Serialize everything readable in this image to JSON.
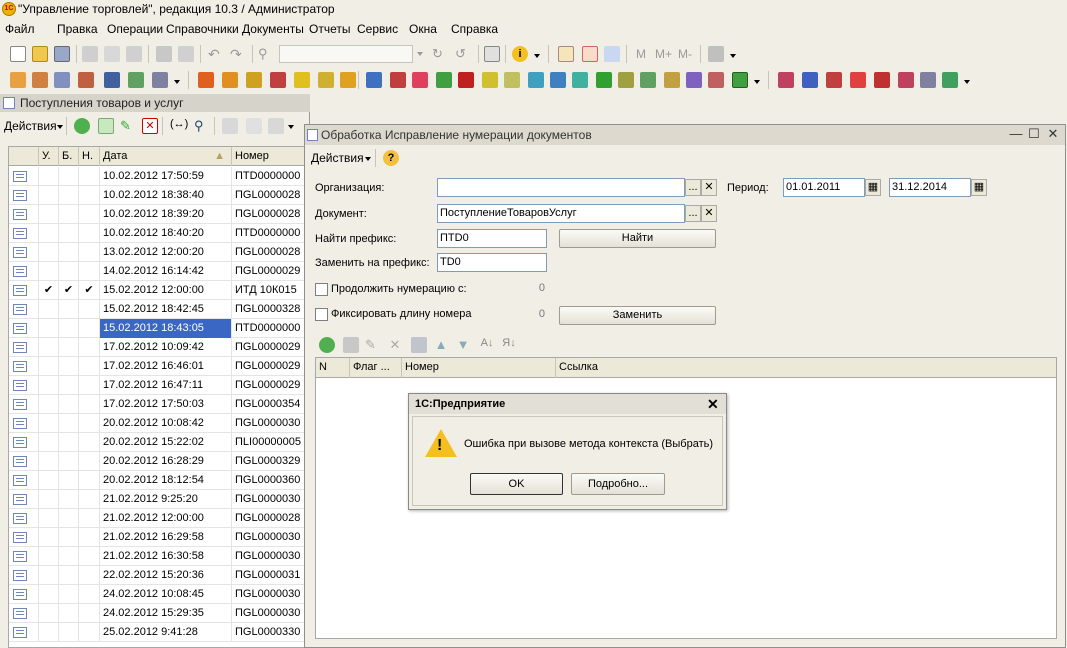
{
  "window": {
    "title": "\"Управление торговлей\", редакция 10.3 / Администратор",
    "logo_text": "1С"
  },
  "menubar": [
    "Файл",
    "Правка",
    "Операции",
    "Справочники",
    "Документы",
    "Отчеты",
    "Сервис",
    "Окна",
    "Справка"
  ],
  "toolbar1": {
    "memory_buttons": [
      "M",
      "M+",
      "M-"
    ]
  },
  "list_window": {
    "title": "Поступления товаров и услуг",
    "actions_label": "Действия",
    "columns": [
      "У.",
      "Б.",
      "Н.",
      "Дата",
      "Номер"
    ],
    "rows": [
      {
        "u": "",
        "b": "",
        "n": "",
        "date": "10.02.2012 17:50:59",
        "number": "ПTD0000000"
      },
      {
        "u": "",
        "b": "",
        "n": "",
        "date": "10.02.2012 18:38:40",
        "number": "ПGL0000028"
      },
      {
        "u": "",
        "b": "",
        "n": "",
        "date": "10.02.2012 18:39:20",
        "number": "ПGL0000028"
      },
      {
        "u": "",
        "b": "",
        "n": "",
        "date": "10.02.2012 18:40:20",
        "number": "ПTD0000000"
      },
      {
        "u": "",
        "b": "",
        "n": "",
        "date": "13.02.2012 12:00:20",
        "number": "ПGL0000028"
      },
      {
        "u": "",
        "b": "",
        "n": "",
        "date": "14.02.2012 16:14:42",
        "number": "ПGL0000029"
      },
      {
        "u": "✔",
        "b": "✔",
        "n": "✔",
        "date": "15.02.2012 12:00:00",
        "number": "ИТД 10К015"
      },
      {
        "u": "",
        "b": "",
        "n": "",
        "date": "15.02.2012 18:42:45",
        "number": "ПGL0000328"
      },
      {
        "u": "",
        "b": "",
        "n": "",
        "date": "15.02.2012 18:43:05",
        "number": "ПTD0000000",
        "selected": true
      },
      {
        "u": "",
        "b": "",
        "n": "",
        "date": "17.02.2012 10:09:42",
        "number": "ПGL0000029"
      },
      {
        "u": "",
        "b": "",
        "n": "",
        "date": "17.02.2012 16:46:01",
        "number": "ПGL0000029"
      },
      {
        "u": "",
        "b": "",
        "n": "",
        "date": "17.02.2012 16:47:11",
        "number": "ПGL0000029"
      },
      {
        "u": "",
        "b": "",
        "n": "",
        "date": "17.02.2012 17:50:03",
        "number": "ПGL0000354"
      },
      {
        "u": "",
        "b": "",
        "n": "",
        "date": "20.02.2012 10:08:42",
        "number": "ПGL0000030"
      },
      {
        "u": "",
        "b": "",
        "n": "",
        "date": "20.02.2012 15:22:02",
        "number": "ПLI00000005"
      },
      {
        "u": "",
        "b": "",
        "n": "",
        "date": "20.02.2012 16:28:29",
        "number": "ПGL0000329"
      },
      {
        "u": "",
        "b": "",
        "n": "",
        "date": "20.02.2012 18:12:54",
        "number": "ПGL0000360"
      },
      {
        "u": "",
        "b": "",
        "n": "",
        "date": "21.02.2012 9:25:20",
        "number": "ПGL0000030"
      },
      {
        "u": "",
        "b": "",
        "n": "",
        "date": "21.02.2012 12:00:00",
        "number": "ПGL0000028"
      },
      {
        "u": "",
        "b": "",
        "n": "",
        "date": "21.02.2012 16:29:58",
        "number": "ПGL0000030"
      },
      {
        "u": "",
        "b": "",
        "n": "",
        "date": "21.02.2012 16:30:58",
        "number": "ПGL0000030"
      },
      {
        "u": "",
        "b": "",
        "n": "",
        "date": "22.02.2012 15:20:36",
        "number": "ПGL0000031"
      },
      {
        "u": "",
        "b": "",
        "n": "",
        "date": "24.02.2012 10:08:45",
        "number": "ПGL0000030"
      },
      {
        "u": "",
        "b": "",
        "n": "",
        "date": "24.02.2012 15:29:35",
        "number": "ПGL0000030"
      },
      {
        "u": "",
        "b": "",
        "n": "",
        "date": "25.02.2012 9:41:28",
        "number": "ПGL0000330"
      }
    ]
  },
  "dialog": {
    "title": "Обработка  Исправление нумерации документов",
    "actions_label": "Действия",
    "help_icon": "?",
    "organization_label": "Организация:",
    "organization_value": "",
    "period_label": "Период:",
    "period_from": "01.01.2011",
    "period_to": "31.12.2014",
    "document_label": "Документ:",
    "document_value": "ПоступлениеТоваровУслуг",
    "find_prefix_label": "Найти префикс:",
    "find_prefix_value": "ПTD0",
    "find_button": "Найти",
    "replace_prefix_label": "Заменить на префикс:",
    "replace_prefix_value": "TD0",
    "continue_numbering_label": "Продолжить нумерацию с:",
    "continue_numbering_value": "0",
    "fix_length_label": "Фиксировать длину номера",
    "fix_length_value": "0",
    "replace_button": "Заменить",
    "ellipsis": "...",
    "clear": "✕",
    "grid_columns": [
      "N",
      "Флаг ...",
      "Номер",
      "Ссылка"
    ]
  },
  "message_box": {
    "title": "1С:Предприятие",
    "text": "Ошибка при вызове метода контекста (Выбрать)",
    "ok_button": "OK",
    "details_button": "Подробно..."
  }
}
